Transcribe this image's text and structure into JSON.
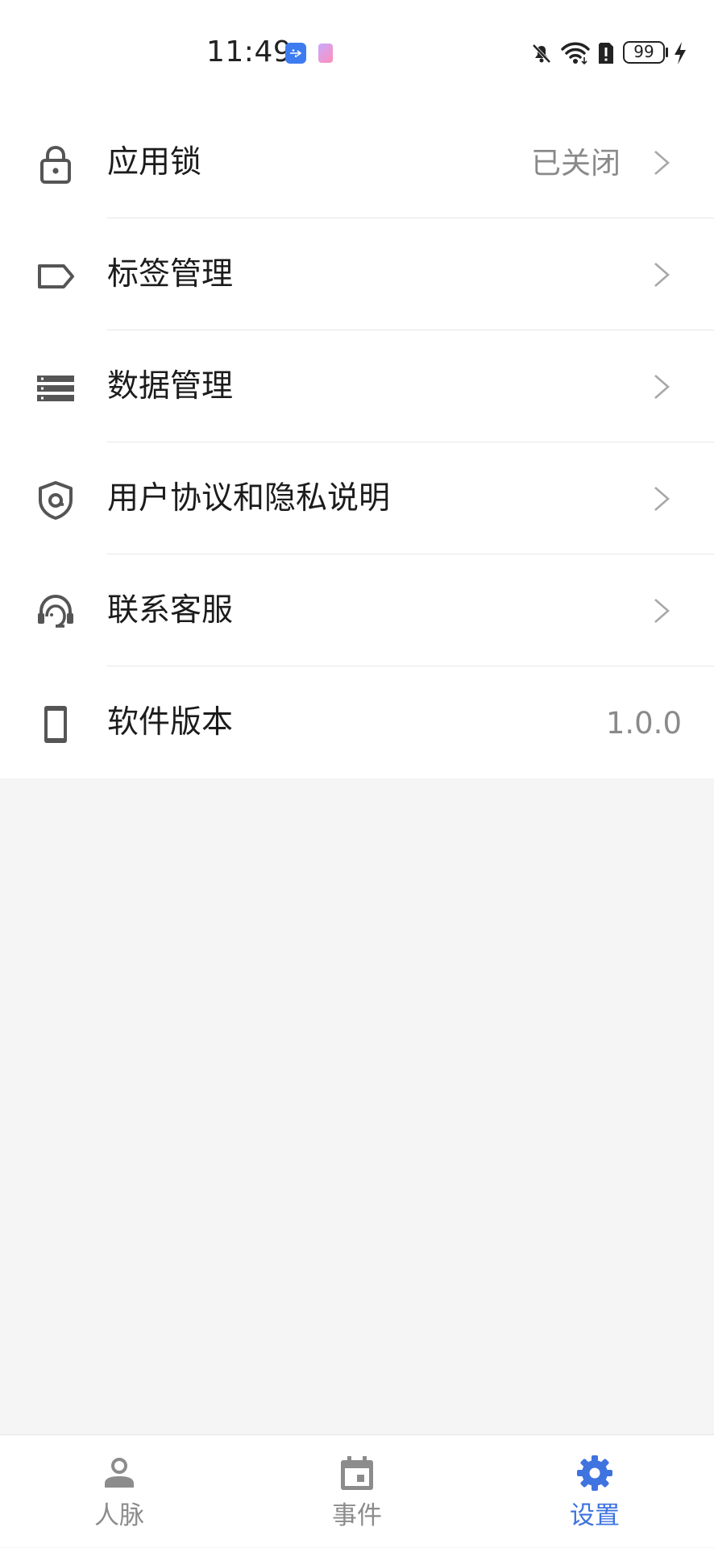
{
  "status_bar": {
    "time": "11:49",
    "battery": "99",
    "icons": [
      "usb-icon",
      "app-notification-icon",
      "bell-muted-icon",
      "wifi-icon",
      "sim-alert-icon",
      "battery-icon",
      "charging-icon"
    ]
  },
  "settings": {
    "items": [
      {
        "label": "应用锁",
        "value": "已关闭",
        "icon": "lock-icon"
      },
      {
        "label": "标签管理",
        "icon": "tag-icon"
      },
      {
        "label": "数据管理",
        "icon": "data-list-icon"
      },
      {
        "label": "用户协议和隐私说明",
        "icon": "shield-icon"
      },
      {
        "label": "联系客服",
        "icon": "customer-service-icon"
      },
      {
        "label": "软件版本",
        "value": "1.0.0",
        "icon": "phone-icon"
      }
    ]
  },
  "bottom_nav": {
    "active": "设置",
    "items": [
      {
        "label": "人脉",
        "icon": "person-icon"
      },
      {
        "label": "事件",
        "icon": "calendar-icon"
      },
      {
        "label": "设置",
        "icon": "gear-icon"
      }
    ]
  },
  "colors": {
    "accent": "#3f73e0",
    "icon_gray": "#555555",
    "text_primary": "#1c1c1c",
    "text_secondary": "#8a8a8a",
    "page_background": "#f5f5f5",
    "divider": "#e6e6e6"
  }
}
